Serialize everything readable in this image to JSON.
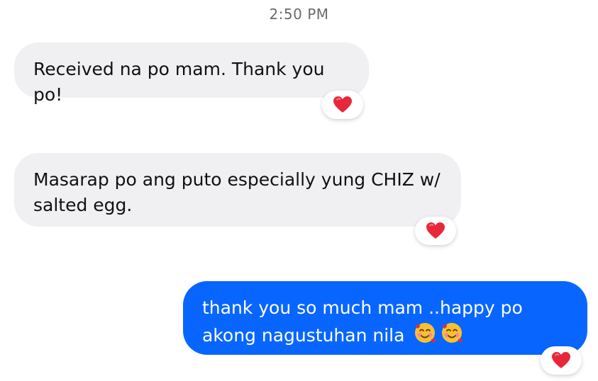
{
  "timestamp": "2:50 PM",
  "messages": [
    {
      "direction": "incoming",
      "text": "Received na po mam. Thank you po!",
      "reaction": "red-heart"
    },
    {
      "direction": "incoming",
      "text": "Masarap po ang puto especially yung CHIZ w/ salted egg.",
      "reaction": "red-heart"
    },
    {
      "direction": "outgoing",
      "text": "thank you so much mam ..happy po akong nagustuhan nila",
      "emojis": [
        "smiling-face-with-hearts",
        "smiling-face-with-hearts"
      ],
      "reaction": "red-heart"
    }
  ],
  "colors": {
    "incoming_bubble": "#f0f0f3",
    "outgoing_bubble": "#0866ff",
    "heart": "#e8283a",
    "timestamp_text": "#6b6b6b"
  }
}
